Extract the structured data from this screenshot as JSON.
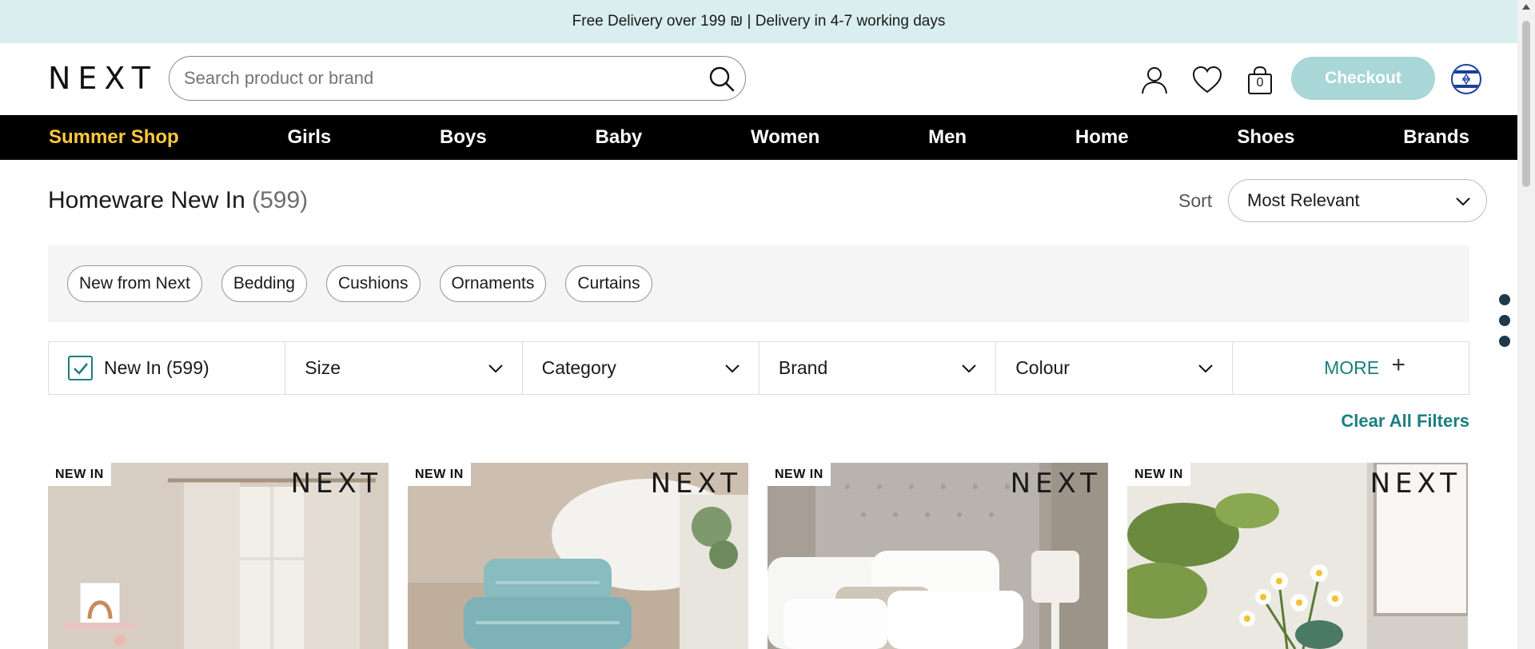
{
  "promo": {
    "text": "Free Delivery over 199 ₪ | Delivery in 4-7 working days"
  },
  "header": {
    "logo": "NEXT",
    "search_placeholder": "Search product or brand",
    "bag_count": "0",
    "checkout_label": "Checkout"
  },
  "nav": {
    "items": [
      {
        "label": "Summer Shop",
        "highlight": true
      },
      {
        "label": "Girls"
      },
      {
        "label": "Boys"
      },
      {
        "label": "Baby"
      },
      {
        "label": "Women"
      },
      {
        "label": "Men"
      },
      {
        "label": "Home"
      },
      {
        "label": "Shoes"
      },
      {
        "label": "Brands"
      }
    ]
  },
  "page": {
    "title": "Homeware New In",
    "count": "(599)",
    "sort_label": "Sort",
    "sort_value": "Most Relevant"
  },
  "quick_links": [
    "New from Next",
    "Bedding",
    "Cushions",
    "Ornaments",
    "Curtains"
  ],
  "filters": {
    "new_in": "New In (599)",
    "size": "Size",
    "category": "Category",
    "brand": "Brand",
    "colour": "Colour",
    "more": "MORE",
    "clear_all": "Clear All Filters"
  },
  "products": [
    {
      "badge": "NEW IN",
      "brand": "NEXT",
      "image": "curtains-bedroom"
    },
    {
      "badge": "NEW IN",
      "brand": "NEXT",
      "image": "towels-bathroom"
    },
    {
      "badge": "NEW IN",
      "brand": "NEXT",
      "image": "bed-pillows"
    },
    {
      "badge": "NEW IN",
      "brand": "NEXT",
      "image": "flowers-vase"
    }
  ],
  "colors": {
    "promo_bg": "#d9eeee",
    "nav_bg": "#000000",
    "nav_highlight": "#ffc93e",
    "accent_teal": "#1b7f7e",
    "checkout_bg": "#a9d6d6"
  }
}
